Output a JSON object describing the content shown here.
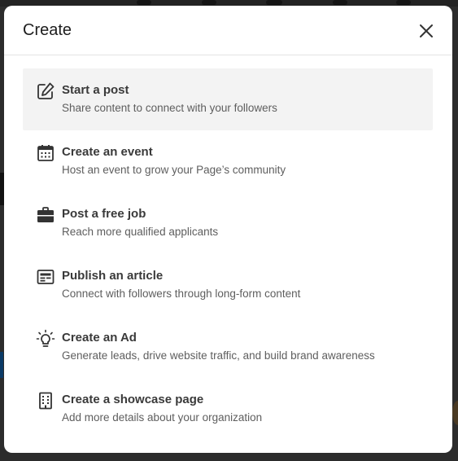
{
  "dialog": {
    "title": "Create",
    "close_icon": "close-icon"
  },
  "options": [
    {
      "title": "Start a post",
      "description": "Share content to connect with your followers",
      "icon": "pencil-square-icon",
      "active": true
    },
    {
      "title": "Create an event",
      "description": "Host an event to grow your Page’s community",
      "icon": "calendar-icon",
      "active": false
    },
    {
      "title": "Post a free job",
      "description": "Reach more qualified applicants",
      "icon": "briefcase-icon",
      "active": false
    },
    {
      "title": "Publish an article",
      "description": "Connect with followers through long-form content",
      "icon": "article-icon",
      "active": false
    },
    {
      "title": "Create an Ad",
      "description": "Generate leads, drive website traffic, and build brand awareness",
      "icon": "lightbulb-icon",
      "active": false
    },
    {
      "title": "Create a showcase page",
      "description": "Add more details about your organization",
      "icon": "building-icon",
      "active": false
    }
  ],
  "colors": {
    "modal_bg": "#ffffff",
    "active_item_bg": "#f3f3f3",
    "title_text": "#3a3a3a",
    "desc_text": "#5e5e5e",
    "backdrop": "#2c2c2c"
  }
}
